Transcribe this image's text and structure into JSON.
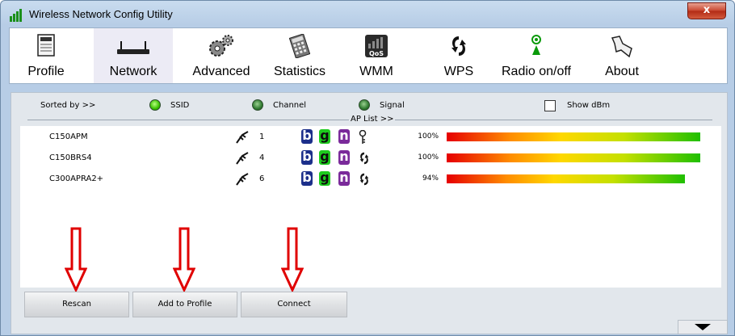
{
  "window": {
    "title": "Wireless Network Config Utility",
    "close_label": "x"
  },
  "toolbar": {
    "tabs": [
      {
        "label": "Profile",
        "icon": "profile-icon"
      },
      {
        "label": "Network",
        "icon": "router-icon",
        "active": true
      },
      {
        "label": "Advanced",
        "icon": "gears-icon"
      },
      {
        "label": "Statistics",
        "icon": "calculator-icon"
      },
      {
        "label": "WMM",
        "icon": "qos-icon"
      },
      {
        "label": "WPS",
        "icon": "wps-icon"
      },
      {
        "label": "Radio on/off",
        "icon": "radio-icon"
      },
      {
        "label": "About",
        "icon": "about-icon"
      }
    ]
  },
  "sort": {
    "label": "Sorted by >>",
    "options": [
      {
        "label": "SSID",
        "selected": true
      },
      {
        "label": "Channel",
        "selected": false
      },
      {
        "label": "Signal",
        "selected": false
      }
    ],
    "show_dbm_label": "Show dBm",
    "show_dbm_checked": false
  },
  "ap_list": {
    "label": "AP List >>",
    "rows": [
      {
        "ssid": "C150APM",
        "channel": "1",
        "modes": [
          "b",
          "g",
          "n"
        ],
        "security": "key-icon",
        "signal": "100%",
        "signal_fraction": 1.0
      },
      {
        "ssid": "C150BRS4",
        "channel": "4",
        "modes": [
          "b",
          "g",
          "n"
        ],
        "security": "wps-icon",
        "signal": "100%",
        "signal_fraction": 1.0
      },
      {
        "ssid": "C300APRA2+",
        "channel": "6",
        "modes": [
          "b",
          "g",
          "n"
        ],
        "security": "wps-icon",
        "signal": "94%",
        "signal_fraction": 0.94
      }
    ]
  },
  "buttons": {
    "rescan": "Rescan",
    "add_to_profile": "Add to Profile",
    "connect": "Connect"
  },
  "colors": {
    "arrow": "#e00000",
    "mode_b": "#1c2f8a",
    "mode_g": "#1ecb1e",
    "mode_n": "#7a2a9a"
  }
}
